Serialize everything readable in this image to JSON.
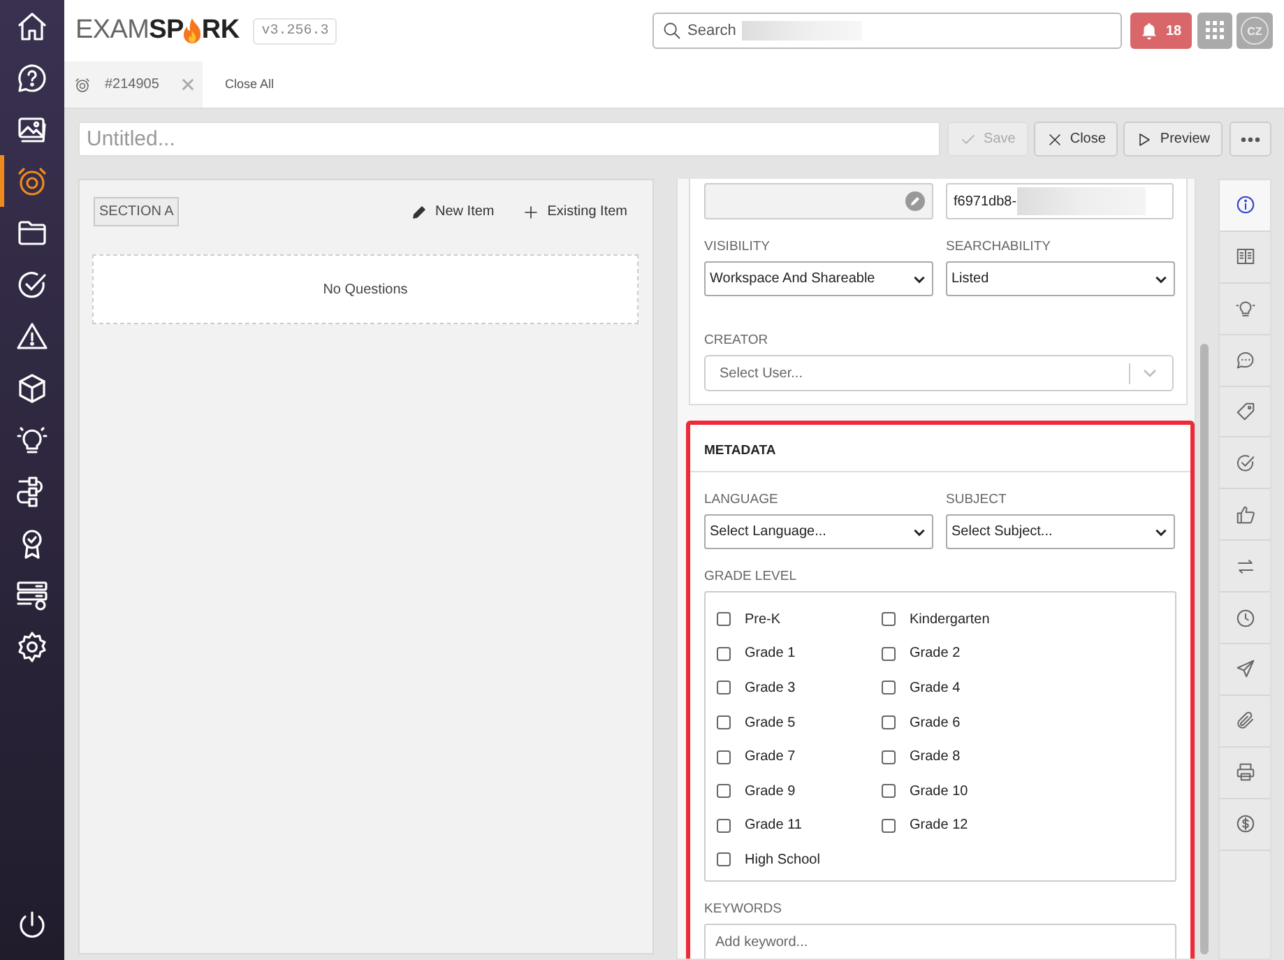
{
  "sidebar": {
    "items": [
      {
        "selected": false
      },
      {
        "selected": false
      },
      {
        "selected": false
      },
      {
        "selected": true
      },
      {
        "selected": false
      },
      {
        "selected": false
      },
      {
        "selected": false
      },
      {
        "selected": false
      },
      {
        "selected": false
      },
      {
        "selected": false
      },
      {
        "selected": false
      },
      {
        "selected": false
      },
      {
        "selected": false
      }
    ]
  },
  "header": {
    "logo": {
      "part_1": "EXAM",
      "part_2": "SP",
      "part_3": "RK"
    },
    "version": "v3.256.3",
    "search": {
      "placeholder": "Search"
    },
    "notifications": "18",
    "avatar": "CZ"
  },
  "tabs": [
    {
      "label": "#214905",
      "selected": true
    }
  ],
  "close_all": "Close All",
  "toolbar": {
    "title_field": {
      "placeholder": "Untitled..."
    },
    "buttons": [
      {
        "kind": "save",
        "label": "Save",
        "disabled": true
      },
      {
        "kind": "close",
        "label": "Close",
        "disabled": false
      },
      {
        "kind": "preview",
        "label": "Preview",
        "disabled": false
      },
      {
        "kind": "more",
        "disabled": false
      }
    ]
  },
  "section": {
    "label": "SECTION A",
    "actions": [
      {
        "kind": "new",
        "label": "New Item"
      },
      {
        "kind": "existing",
        "label": "Existing Item"
      }
    ],
    "empty": "No Questions"
  },
  "details": {
    "id_value": "f6971db8-",
    "visibility": {
      "label": "VISIBILITY",
      "value": "Workspace And Shareable"
    },
    "searchability": {
      "label": "SEARCHABILITY",
      "value": "Listed"
    },
    "creator": {
      "label": "CREATOR",
      "placeholder": "Select User..."
    }
  },
  "metadata": {
    "title": "METADATA",
    "highlighted": true,
    "language": {
      "label": "LANGUAGE",
      "value": "Select Language..."
    },
    "subject": {
      "label": "SUBJECT",
      "value": "Select Subject..."
    },
    "grade_level": {
      "label": "GRADE LEVEL",
      "grades": [
        {
          "label": "Pre-K",
          "checked": false
        },
        {
          "label": "Kindergarten",
          "checked": false
        },
        {
          "label": "Grade 1",
          "checked": false
        },
        {
          "label": "Grade 2",
          "checked": false
        },
        {
          "label": "Grade 3",
          "checked": false
        },
        {
          "label": "Grade 4",
          "checked": false
        },
        {
          "label": "Grade 5",
          "checked": false
        },
        {
          "label": "Grade 6",
          "checked": false
        },
        {
          "label": "Grade 7",
          "checked": false
        },
        {
          "label": "Grade 8",
          "checked": false
        },
        {
          "label": "Grade 9",
          "checked": false
        },
        {
          "label": "Grade 10",
          "checked": false
        },
        {
          "label": "Grade 11",
          "checked": false
        },
        {
          "label": "Grade 12",
          "checked": false
        },
        {
          "label": "High School",
          "checked": false
        }
      ]
    },
    "keywords": {
      "label": "KEYWORDS",
      "placeholder": "Add keyword..."
    }
  },
  "rail": {
    "items": [
      {
        "selected": true
      },
      {
        "selected": false
      },
      {
        "selected": false
      },
      {
        "selected": false
      },
      {
        "selected": false
      },
      {
        "selected": false
      },
      {
        "selected": false
      },
      {
        "selected": false
      },
      {
        "selected": false
      },
      {
        "selected": false
      },
      {
        "selected": false
      },
      {
        "selected": false
      },
      {
        "selected": false
      }
    ]
  }
}
